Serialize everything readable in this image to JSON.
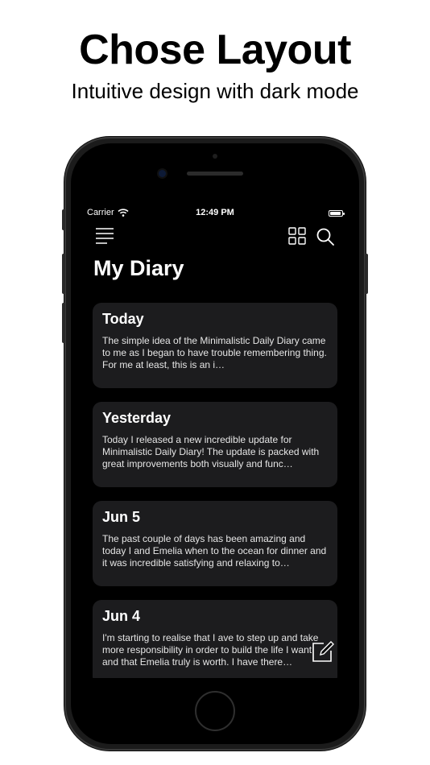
{
  "promo": {
    "title": "Chose Layout",
    "subtitle": "Intuitive design with dark mode"
  },
  "status_bar": {
    "carrier": "Carrier",
    "time": "12:49 PM",
    "battery_level": 0.9
  },
  "toolbar": {
    "icons": [
      "menu-icon",
      "grid-icon",
      "search-icon"
    ]
  },
  "page": {
    "title": "My Diary"
  },
  "entries": [
    {
      "date": "Today",
      "preview": "The simple idea of the Minimalistic Daily Diary came to me as I began to have trouble remembering thing. For me at least, this is an i…"
    },
    {
      "date": "Yesterday",
      "preview": "Today I released a new incredible update for Minimalistic Daily Diary! The update is packed with great improvements both visually and func…"
    },
    {
      "date": "Jun 5",
      "preview": "The past couple of days has been amazing and today I and Emelia when to the ocean for dinner and it was incredible satisfying and relaxing to…"
    },
    {
      "date": "Jun 4",
      "preview": "I'm starting to realise that I ave to step up and take more responsibility in order to build the life I want and that Emelia truly is worth. I have there…"
    }
  ],
  "colors": {
    "background": "#000000",
    "card": "#1c1c1e",
    "text": "#ffffff"
  }
}
